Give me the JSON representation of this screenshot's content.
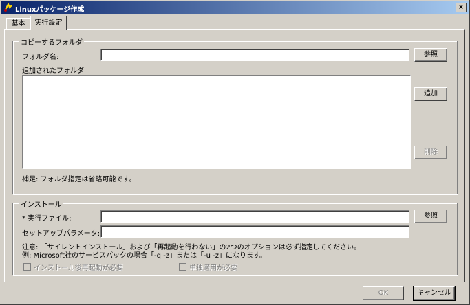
{
  "window": {
    "title": "Linuxパッケージ作成",
    "close_label": "×"
  },
  "tabs": [
    {
      "label": "基本"
    },
    {
      "label": "実行設定"
    }
  ],
  "copy_group": {
    "legend": "コピーするフォルダ",
    "folder_label": "フォルダ名:",
    "folder_value": "",
    "browse_label": "参照",
    "added_label": "追加されたフォルダ",
    "add_label": "追加",
    "delete_label": "削除",
    "note": "補足: フォルダ指定は省略可能です。"
  },
  "install_group": {
    "legend": "インストール",
    "exec_label": "* 実行ファイル:",
    "exec_value": "",
    "browse_label": "参照",
    "param_label": "セットアップパラメータ:",
    "param_value": "",
    "note_line1": "注意: 「サイレントインストール」および「再起動を行わない」の2つのオプションは必ず指定してください。",
    "note_line2": "例: Microsoft社のサービスパックの場合「-q -z」または「-u -z」になります。",
    "reboot_checkbox": "インストール後再起動が必要",
    "single_checkbox": "単独適用が必要"
  },
  "footer": {
    "ok_label": "OK",
    "cancel_label": "キャンセル"
  }
}
